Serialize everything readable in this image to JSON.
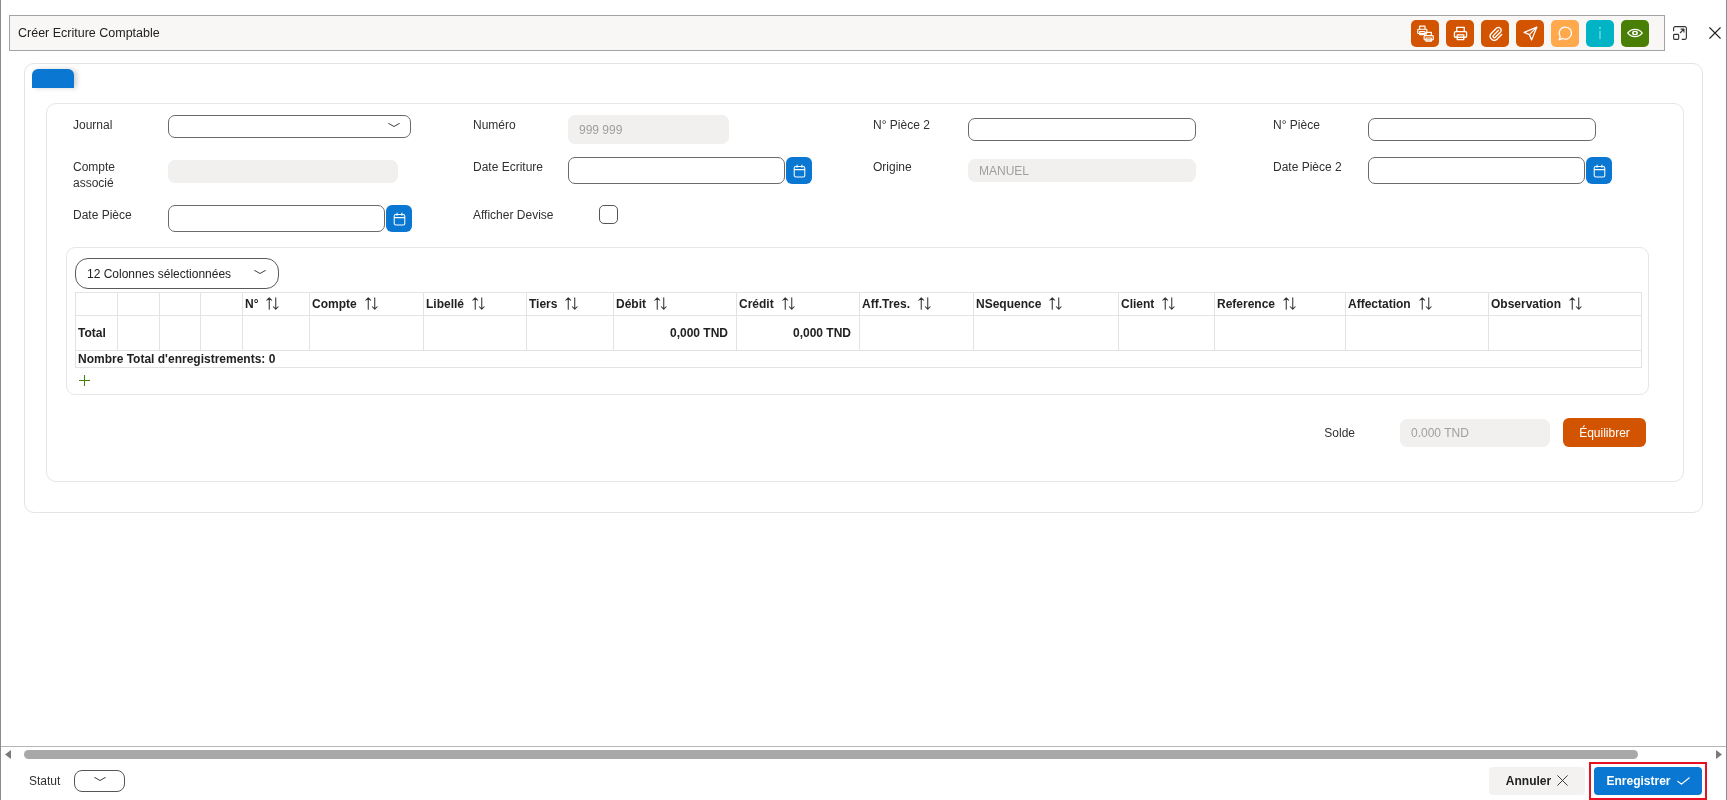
{
  "window": {
    "title": "Créer Ecriture Comptable"
  },
  "toolbar": [
    {
      "kind": "print-multiple",
      "color": "#d35400"
    },
    {
      "kind": "print",
      "color": "#d35400"
    },
    {
      "kind": "attach",
      "color": "#d35400"
    },
    {
      "kind": "send",
      "color": "#d35400"
    },
    {
      "kind": "comment",
      "color": "#ffa84c"
    },
    {
      "kind": "info",
      "color": "#00b4c6"
    },
    {
      "kind": "view",
      "color": "#4a7f05"
    }
  ],
  "tabs": [
    {
      "selected": true
    }
  ],
  "form": {
    "fields": [
      {
        "kind": "select",
        "label": "Journal",
        "disabled": false
      },
      {
        "kind": "text",
        "label": "Numéro",
        "value": "999 999",
        "disabled": true
      },
      {
        "kind": "text",
        "label": "N° Pièce 2",
        "disabled": false
      },
      {
        "kind": "text",
        "label": "N° Pièce",
        "disabled": false
      },
      {
        "kind": "text",
        "label": "Compte associé",
        "disabled": true
      },
      {
        "kind": "date",
        "label": "Date Ecriture",
        "disabled": false
      },
      {
        "kind": "text",
        "label": "Origine",
        "value": "MANUEL",
        "disabled": true
      },
      {
        "kind": "date",
        "label": "Date Pièce 2",
        "disabled": false
      },
      {
        "kind": "date",
        "label": "Date Pièce",
        "disabled": false
      },
      {
        "kind": "checkbox",
        "label": "Afficher Devise",
        "checked": false
      }
    ]
  },
  "table": {
    "column_selector": "12 Colonnes sélectionnées",
    "columns": [
      {
        "kind": "blank",
        "total": "Total"
      },
      {
        "kind": "blank"
      },
      {
        "kind": "blank"
      },
      {
        "kind": "blank"
      },
      {
        "kind": "sortable",
        "label": "N°"
      },
      {
        "kind": "sortable",
        "label": "Compte"
      },
      {
        "kind": "sortable",
        "label": "Libellé"
      },
      {
        "kind": "sortable",
        "label": "Tiers"
      },
      {
        "kind": "sortable",
        "label": "Débit",
        "total": "0,000 TND"
      },
      {
        "kind": "sortable",
        "label": "Crédit",
        "total": "0,000 TND"
      },
      {
        "kind": "sortable",
        "label": "Aff.Tres."
      },
      {
        "kind": "sortable",
        "label": "NSequence"
      },
      {
        "kind": "sortable",
        "label": "Client"
      },
      {
        "kind": "sortable",
        "label": "Reference"
      },
      {
        "kind": "sortable",
        "label": "Affectation"
      },
      {
        "kind": "sortable",
        "label": "Observation"
      }
    ],
    "record_count": "Nombre Total d'enregistrements: 0"
  },
  "balance": {
    "label": "Solde",
    "value": "0.000 TND",
    "disabled": true,
    "button": "Équilibrer"
  },
  "footer": {
    "status": {
      "label": "Statut"
    },
    "buttons": [
      {
        "kind": "cancel",
        "label": "Annuler",
        "highlighted": false
      },
      {
        "kind": "save",
        "label": "Enregistrer",
        "highlighted": true
      }
    ]
  }
}
